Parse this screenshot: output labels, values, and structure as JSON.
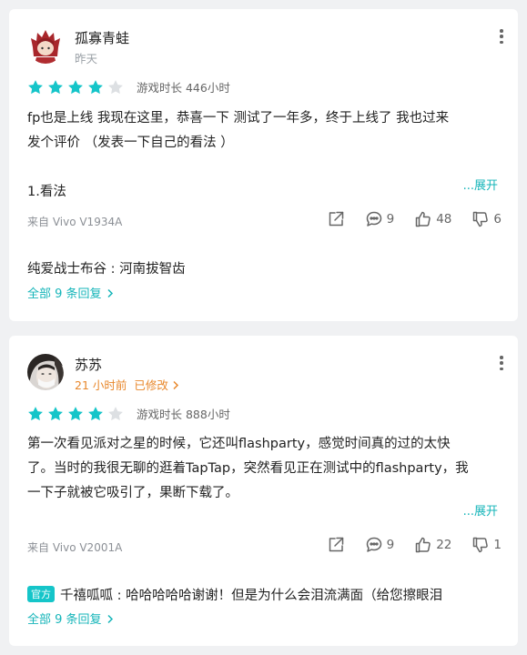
{
  "colors": {
    "accent": "#15b5b9",
    "star_on": "#15c5c9",
    "star_off": "#dde0e3",
    "highlight": "#e8872b"
  },
  "reviews": [
    {
      "username": "孤寡青蛙",
      "time": "昨天",
      "rating": 4,
      "max_rating": 5,
      "playtime": "游戏时长 446小时",
      "text": "fp也是上线 我现在这里，恭喜一下 测试了一年多，终于上线了 我也过来\n发个评价 （发表一下自己的看法 ）\n\n1.看法",
      "expand_label": "...展开",
      "device": "来自 Vivo V1934A",
      "replies": "9",
      "likes": "48",
      "dislikes": "6",
      "reply_preview": "纯爱战士布谷 : 河南拔智齿",
      "all_replies_label": "全部 9 条回复"
    },
    {
      "username": "苏苏",
      "time": "21 小时前",
      "edited": "已修改",
      "rating": 4,
      "max_rating": 5,
      "playtime": "游戏时长 888小时",
      "text": "第一次看见派对之星的时候，它还叫flashparty，感觉时间真的过的太快\n了。当时的我很无聊的逛着TapTap，突然看见正在测试中的flashparty，我\n一下子就被它吸引了，果断下载了。",
      "expand_label": "...展开",
      "device": "来自 Vivo V2001A",
      "replies": "9",
      "likes": "22",
      "dislikes": "1",
      "reply_badge": "官方",
      "reply_name": "千禧呱呱",
      "reply_text": " : 哈哈哈哈哈谢谢！但是为什么会泪流满面（给您擦眼泪",
      "all_replies_label": "全部 9 条回复"
    }
  ]
}
